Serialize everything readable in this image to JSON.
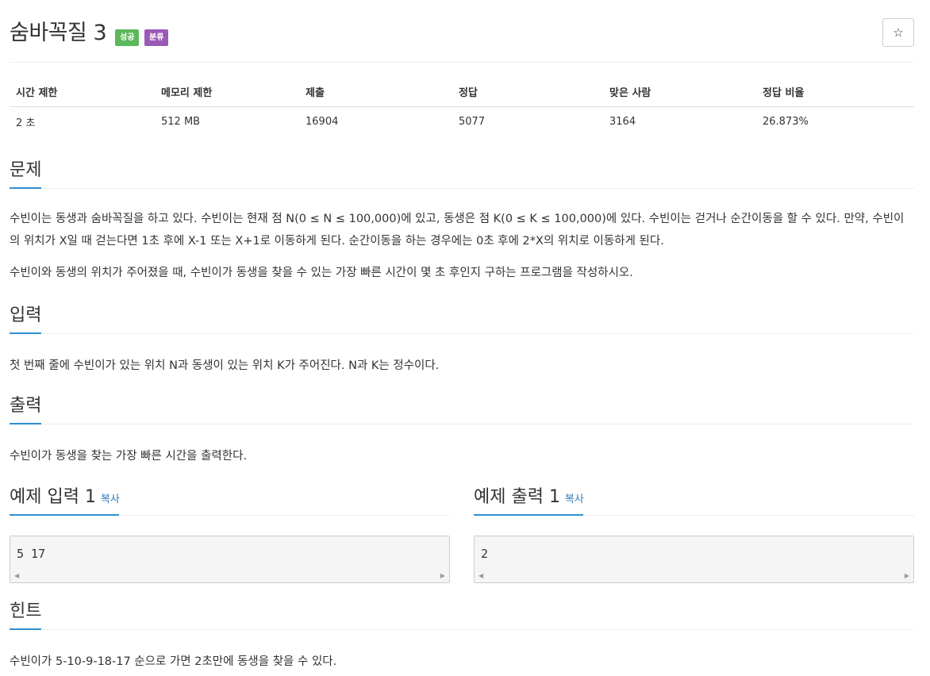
{
  "problem": {
    "title": "숨바꼭질 3",
    "badge_success": "성공",
    "badge_class": "분류",
    "star_icon": "☆"
  },
  "info_table": {
    "headers": [
      "시간 제한",
      "메모리 제한",
      "제출",
      "정답",
      "맞은 사람",
      "정답 비율"
    ],
    "values": [
      "2 초",
      "512 MB",
      "16904",
      "5077",
      "3164",
      "26.873%"
    ]
  },
  "sections": {
    "description": {
      "title": "문제",
      "para1": "수빈이는 동생과 숨바꼭질을 하고 있다. 수빈이는 현재 점 N(0 ≤ N ≤ 100,000)에 있고, 동생은 점 K(0 ≤ K ≤ 100,000)에 있다. 수빈이는 걷거나 순간이동을 할 수 있다. 만약, 수빈이의 위치가 X일 때 걷는다면 1초 후에 X-1 또는 X+1로 이동하게 된다. 순간이동을 하는 경우에는 0초 후에 2*X의 위치로 이동하게 된다.",
      "para2": "수빈이와 동생의 위치가 주어졌을 때, 수빈이가 동생을 찾을 수 있는 가장 빠른 시간이 몇 초 후인지 구하는 프로그램을 작성하시오."
    },
    "input": {
      "title": "입력",
      "text": "첫 번째 줄에 수빈이가 있는 위치 N과 동생이 있는 위치 K가 주어진다. N과 K는 정수이다."
    },
    "output": {
      "title": "출력",
      "text": "수빈이가 동생을 찾는 가장 빠른 시간을 출력한다."
    },
    "sample_input": {
      "title": "예제 입력 1",
      "copy": "복사",
      "value": "5 17"
    },
    "sample_output": {
      "title": "예제 출력 1",
      "copy": "복사",
      "value": "2"
    },
    "hint": {
      "title": "힌트",
      "text": "수빈이가 5-10-9-18-17 순으로 가면 2초만에 동생을 찾을 수 있다."
    }
  },
  "colors": {
    "accent": "#2c8fd1",
    "badge_success": "#5cb85c",
    "badge_class": "#9b59b6",
    "link": "#337ab7"
  }
}
